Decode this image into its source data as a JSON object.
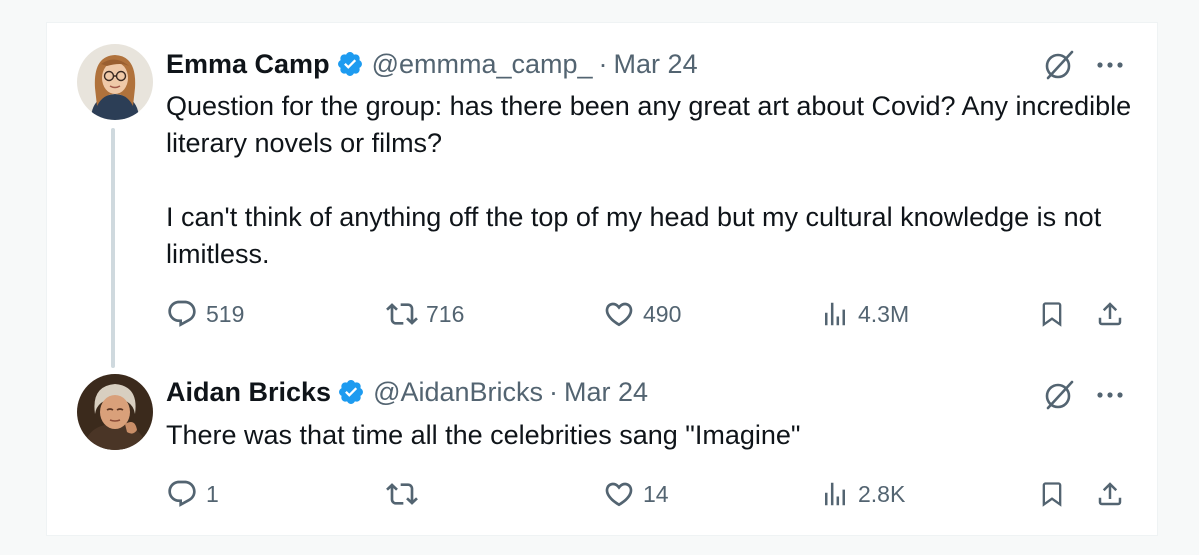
{
  "tweets": [
    {
      "name": "Emma Camp",
      "handle": "@emmma_camp_",
      "separator": "·",
      "date": "Mar 24",
      "text": "Question for the group: has there been any great art about Covid? Any incredible literary novels or films?\n\nI can't think of anything off the top of my head but my cultural knowledge is not limitless.",
      "replies": "519",
      "reposts": "716",
      "likes": "490",
      "views": "4.3M"
    },
    {
      "name": "Aidan Bricks",
      "handle": "@AidanBricks",
      "separator": "·",
      "date": "Mar 24",
      "text": "There was that time all the celebrities sang \"Imagine\"",
      "replies": "1",
      "reposts": "",
      "likes": "14",
      "views": "2.8K"
    }
  ],
  "icons": {
    "verified": "verified-badge-icon",
    "grok": "grok-icon",
    "more": "more-icon",
    "reply": "reply-icon",
    "repost": "repost-icon",
    "like": "like-icon",
    "views": "views-icon",
    "bookmark": "bookmark-icon",
    "share": "share-icon"
  },
  "colors": {
    "verified": "#1d9bf0",
    "text": "#0f1419",
    "secondary": "#536471",
    "thread_line": "#cfd9de"
  }
}
